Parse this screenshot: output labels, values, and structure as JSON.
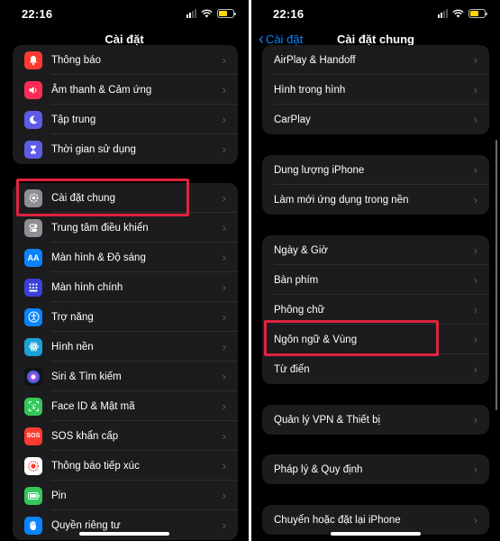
{
  "status": {
    "time": "22:16"
  },
  "colors": {
    "accent": "#0a84ff",
    "highlight": "#e0233f",
    "group_bg": "#1c1c1e",
    "icon_red": "#ff3b30",
    "icon_pink": "#ff2d55",
    "icon_purple": "#5e5ce6",
    "icon_gray": "#8e8e93",
    "icon_blue": "#0a84ff",
    "icon_green": "#34c759"
  },
  "left": {
    "title": "Cài đặt",
    "group1": [
      {
        "label": "Thông báo",
        "icon": "bell-icon"
      },
      {
        "label": "Âm thanh & Cảm ứng",
        "icon": "speaker-icon"
      },
      {
        "label": "Tập trung",
        "icon": "moon-icon"
      },
      {
        "label": "Thời gian sử dụng",
        "icon": "hourglass-icon"
      }
    ],
    "group2": [
      {
        "label": "Cài đặt chung",
        "icon": "gear-icon"
      },
      {
        "label": "Trung tâm điều khiển",
        "icon": "toggles-icon"
      },
      {
        "label": "Màn hình & Độ sáng",
        "icon": "aa-icon"
      },
      {
        "label": "Màn hình chính",
        "icon": "grid-icon"
      },
      {
        "label": "Trợ năng",
        "icon": "accessibility-icon"
      },
      {
        "label": "Hình nền",
        "icon": "flower-icon"
      },
      {
        "label": "Siri & Tìm kiếm",
        "icon": "siri-icon"
      },
      {
        "label": "Face ID & Mật mã",
        "icon": "faceid-icon"
      },
      {
        "label": "SOS khẩn cấp",
        "icon": "sos-icon"
      },
      {
        "label": "Thông báo tiếp xúc",
        "icon": "exposure-icon"
      },
      {
        "label": "Pin",
        "icon": "battery-icon"
      },
      {
        "label": "Quyền riêng tư",
        "icon": "hand-icon"
      }
    ],
    "icon_text": {
      "aa": "AA",
      "sos": "SOS"
    }
  },
  "right": {
    "title": "Cài đặt chung",
    "back": "Cài đặt",
    "group1": [
      "AirPlay & Handoff",
      "Hình trong hình",
      "CarPlay"
    ],
    "group2": [
      "Dung lượng iPhone",
      "Làm mới ứng dụng trong nền"
    ],
    "group3": [
      "Ngày & Giờ",
      "Bàn phím",
      "Phông chữ",
      "Ngôn ngữ & Vùng",
      "Từ điển"
    ],
    "group4": [
      "Quản lý VPN & Thiết bị"
    ],
    "group5": [
      "Pháp lý & Quy định"
    ],
    "group6": [
      "Chuyển hoặc đặt lại iPhone"
    ]
  }
}
